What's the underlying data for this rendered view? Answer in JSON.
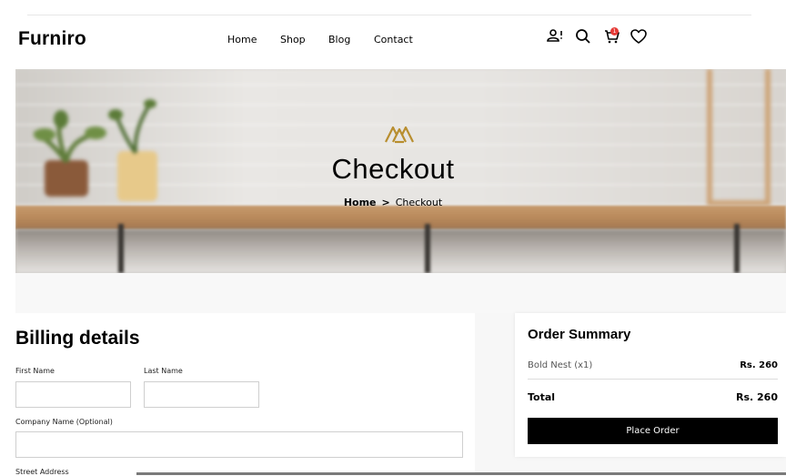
{
  "brand": {
    "logo": "Furniro"
  },
  "nav": {
    "items": [
      "Home",
      "Shop",
      "Blog",
      "Contact"
    ]
  },
  "header_icons": {
    "account": "user-alert-icon",
    "search": "search-icon",
    "cart": "cart-icon",
    "cart_count": "1",
    "wishlist": "heart-icon"
  },
  "hero": {
    "title": "Checkout",
    "breadcrumb": {
      "home": "Home",
      "separator": ">",
      "current": "Checkout"
    },
    "accent_color": "#B88E2F"
  },
  "billing": {
    "heading": "Billing details",
    "fields": {
      "first_name": {
        "label": "First Name",
        "value": ""
      },
      "last_name": {
        "label": "Last Name",
        "value": ""
      },
      "company": {
        "label": "Company Name (Optional)",
        "value": ""
      },
      "street": {
        "label": "Street Address"
      }
    }
  },
  "summary": {
    "heading": "Order Summary",
    "items": [
      {
        "name": "Bold Nest (x1)",
        "price": "Rs. 260"
      }
    ],
    "total_label": "Total",
    "total_value": "Rs. 260",
    "place_order_label": "Place Order"
  }
}
